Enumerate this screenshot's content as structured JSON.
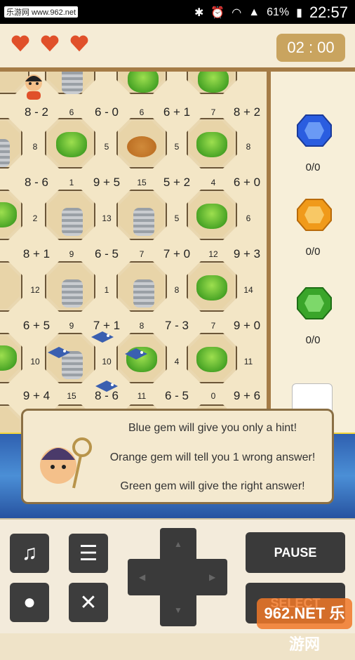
{
  "status_bar": {
    "watermark": "乐游网 www.962.net",
    "battery": "61%",
    "time": "22:57"
  },
  "lives": {
    "count": 3,
    "color": "#e0502a"
  },
  "timer": "02 : 00",
  "board": {
    "tiles": [
      {
        "c": "bush"
      },
      {
        "c": "rock"
      },
      {
        "c": "bush"
      },
      {
        "c": "bush"
      },
      {
        "c": "char"
      },
      {
        "c": "bush"
      },
      {
        "c": "dirt"
      },
      {
        "c": "bush"
      },
      {
        "c": "bush"
      },
      {
        "c": "rock"
      },
      {
        "c": "rock"
      },
      {
        "c": "bush"
      },
      {
        "c": "rock"
      },
      {
        "c": "rock"
      },
      {
        "c": "bush"
      },
      {
        "c": "bush"
      },
      {
        "c": "rock"
      },
      {
        "c": "bush"
      },
      {
        "c": "bush"
      }
    ],
    "rows": [
      {
        "exprs": [
          "8 - 2",
          "6 - 0",
          "6 + 1",
          "8 + 2"
        ],
        "nums": [
          "6",
          "6",
          "7"
        ]
      },
      {
        "exprs": [
          "8 - 6",
          "9 + 5",
          "5 + 2",
          "6 + 0"
        ],
        "nums": [
          "1",
          "15",
          "4"
        ]
      },
      {
        "exprs": [
          "8 + 1",
          "6 - 5",
          "7 + 0",
          "9 + 3"
        ],
        "nums": [
          "9",
          "7",
          "12"
        ]
      },
      {
        "exprs": [
          "6 + 5",
          "7 + 1",
          "7 - 3",
          "9 + 0"
        ],
        "nums": [
          "9",
          "8",
          "7"
        ]
      },
      {
        "exprs": [
          "9 + 4",
          "8 - 6",
          "6 - 5",
          "9 + 6"
        ],
        "nums": [
          "15",
          "11",
          "0"
        ]
      }
    ],
    "side_nums": [
      [
        "8",
        "5",
        "5",
        "8"
      ],
      [
        "2",
        "13",
        "5",
        "6"
      ],
      [
        "12",
        "1",
        "8",
        "14"
      ],
      [
        "10",
        "10",
        "4",
        "11"
      ]
    ]
  },
  "gems": [
    {
      "color": "blue",
      "hex": "#2a5de0",
      "count": "0/0"
    },
    {
      "color": "orange",
      "hex": "#f09a1a",
      "count": "0/0"
    },
    {
      "color": "green",
      "hex": "#3aa52a",
      "count": "0/0"
    }
  ],
  "dialog": {
    "lines": [
      "Blue gem will give you only a hint!",
      "Orange gem will tell you 1 wrong answer!",
      "Green gem will give the right answer!"
    ]
  },
  "controls": {
    "pause": "PAUSE",
    "select": "SELECT",
    "watermark": "962.NET 乐游网"
  }
}
